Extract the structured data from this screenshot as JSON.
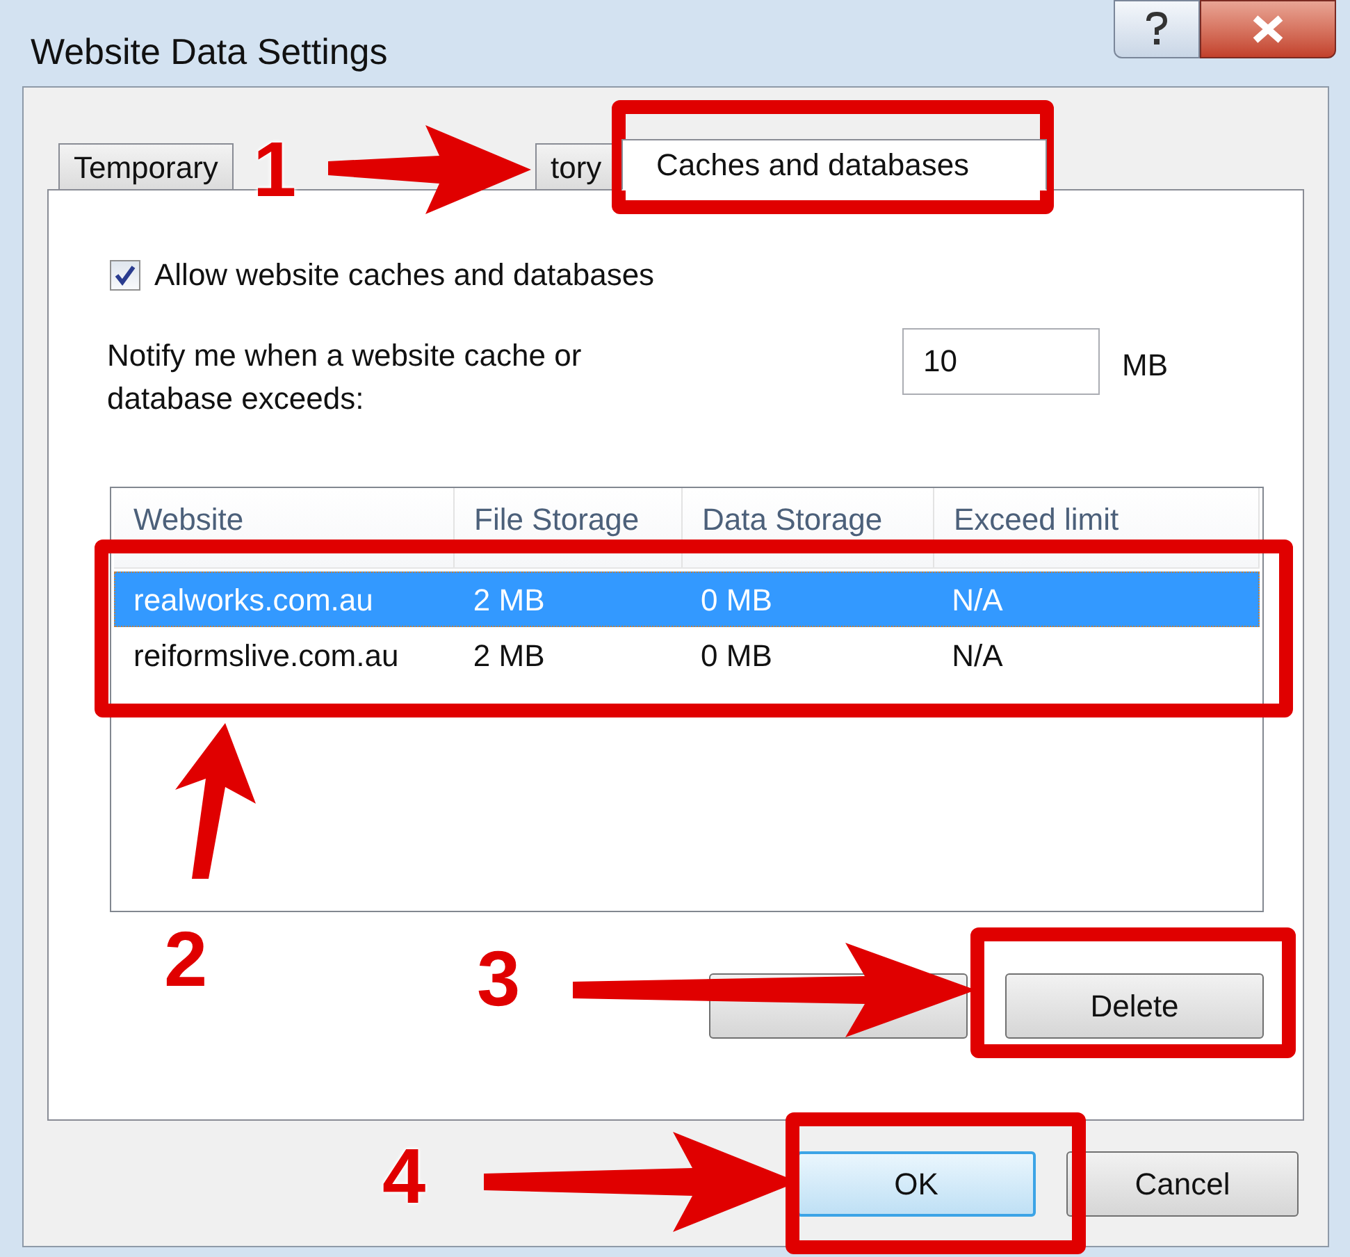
{
  "window": {
    "title": "Website Data Settings"
  },
  "tabs": [
    {
      "label": "Temporary",
      "selected": false
    },
    {
      "label": "tory",
      "selected": false
    },
    {
      "label": "Caches and databases",
      "selected": true
    }
  ],
  "allow_checkbox": {
    "label": "Allow website caches and databases",
    "checked": true
  },
  "notify": {
    "label": "Notify me when a website cache or database exceeds:",
    "value": "10",
    "unit": "MB"
  },
  "table": {
    "columns": [
      "Website",
      "File Storage",
      "Data Storage",
      "Exceed limit"
    ],
    "rows": [
      {
        "cells": [
          "realworks.com.au",
          "2 MB",
          "0 MB",
          "N/A"
        ],
        "selected": true
      },
      {
        "cells": [
          "reiformslive.com.au",
          "2 MB",
          "0 MB",
          "N/A"
        ],
        "selected": false
      }
    ]
  },
  "panel_buttons": [
    {
      "label": "Delete"
    }
  ],
  "dialog_buttons": [
    {
      "label": "OK",
      "default": true
    },
    {
      "label": "Cancel",
      "default": false
    }
  ],
  "annotations": [
    {
      "number": "1"
    },
    {
      "number": "2"
    },
    {
      "number": "3"
    },
    {
      "number": "4"
    }
  ]
}
